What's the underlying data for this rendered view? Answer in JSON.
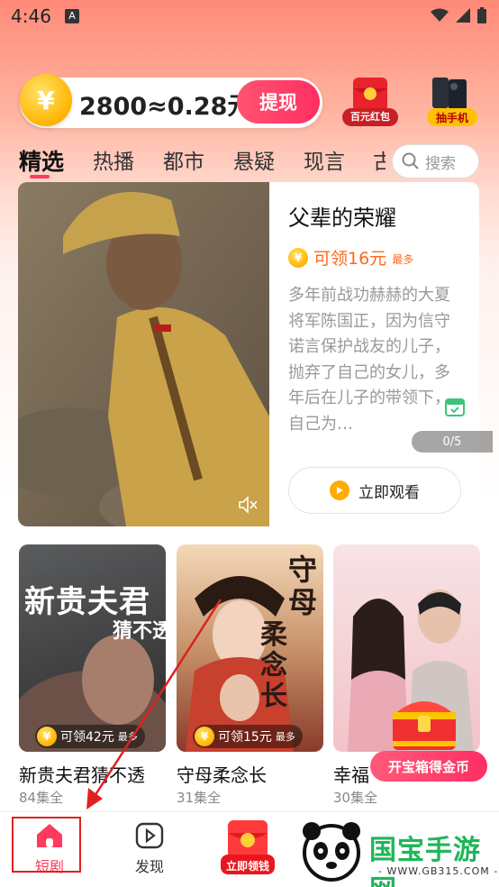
{
  "status_bar": {
    "time": "4:46",
    "notif_badge": "A"
  },
  "coin_bar": {
    "coin_symbol": "¥",
    "balance_text": "2800≈0.28元",
    "withdraw_label": "提现",
    "redpack_label": "百元红包",
    "phone_label": "抽手机"
  },
  "tabs": [
    {
      "label": "精选",
      "active": true
    },
    {
      "label": "热播"
    },
    {
      "label": "都市"
    },
    {
      "label": "悬疑"
    },
    {
      "label": "现言"
    },
    {
      "label": "古"
    }
  ],
  "search": {
    "placeholder": "搜索"
  },
  "featured": {
    "title": "父辈的荣耀",
    "reward": "可领16元",
    "reward_max": "最多",
    "description": "多年前战功赫赫的大夏将军陈国正，因为信守诺言保护战友的儿子，抛弃了自己的女儿，多年后在儿子的带领下，自己为…",
    "page_indicator": "0/5",
    "watch_label": "立即观看"
  },
  "dramas": [
    {
      "title": "新贵夫君猜不透",
      "episodes": "84集全",
      "reward": "可领42元",
      "reward_max": "最多",
      "poster_text_1": "新贵夫君",
      "poster_text_2": "猜不透"
    },
    {
      "title": "守母柔念长",
      "episodes": "31集全",
      "reward": "可领15元",
      "reward_max": "最多",
      "poster_text_1": "守母",
      "poster_text_2": "柔念长"
    },
    {
      "title": "幸福",
      "episodes": "30集全",
      "reward": "",
      "reward_max": ""
    }
  ],
  "chest": {
    "label": "开宝箱得金币"
  },
  "bottom_nav": [
    {
      "label": "短剧",
      "active": true
    },
    {
      "label": "发现"
    },
    {
      "label": "立即领钱"
    }
  ],
  "watermark": {
    "brand": "国宝手游网",
    "url": "- WWW.GB315.COM -"
  },
  "colors": {
    "accent": "#ff3a5c",
    "reward": "#ff6a1a"
  }
}
